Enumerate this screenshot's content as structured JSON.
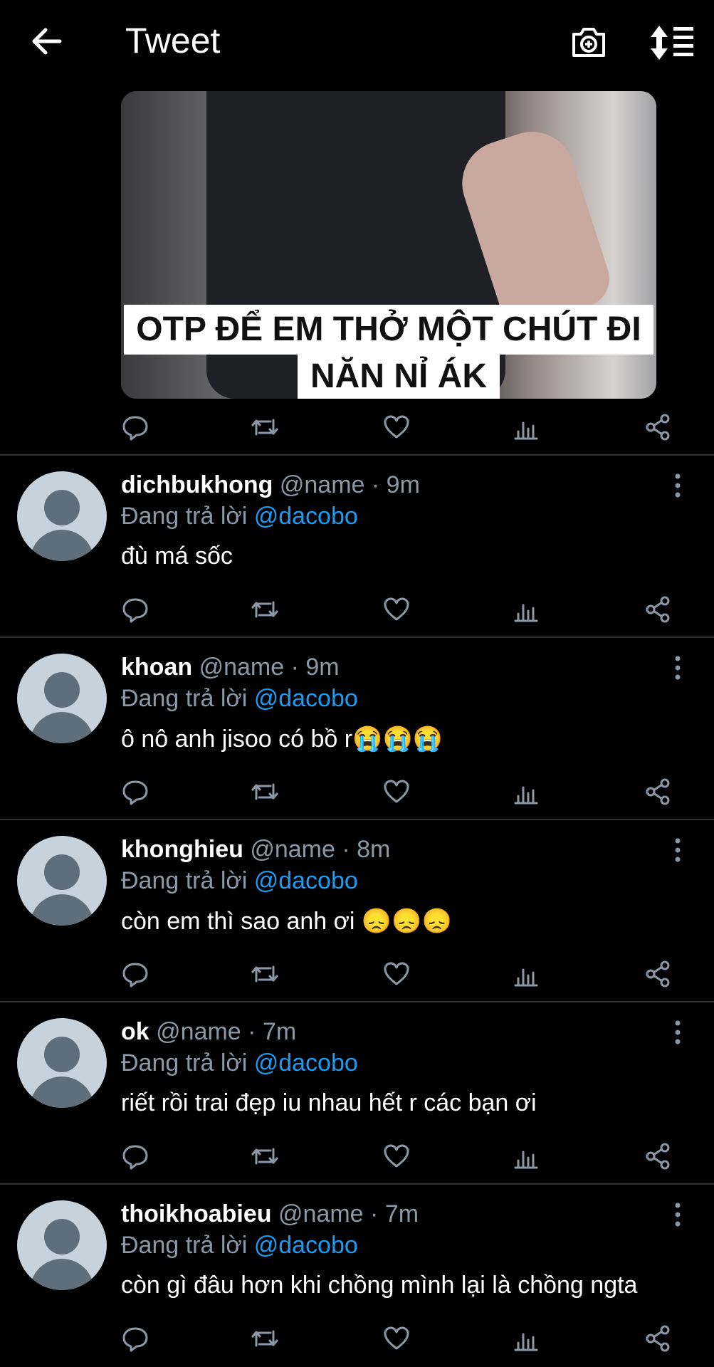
{
  "header": {
    "title": "Tweet",
    "back_icon": "arrow-left-icon",
    "camera_icon": "camera-plus-icon",
    "sort_icon": "sort-list-icon"
  },
  "media": {
    "caption_line1": "OTP ĐỂ EM THỞ MỘT CHÚT ĐI",
    "caption_line2": "NĂN NỈ ÁK"
  },
  "replying_prefix": "Đang trả lời ",
  "replies": [
    {
      "username": "dichbukhong",
      "handle": "@name",
      "time": "9m",
      "mention": "@dacobo",
      "text": "đù má sốc"
    },
    {
      "username": "khoan",
      "handle": "@name",
      "time": "9m",
      "mention": "@dacobo",
      "text": "ô nô anh jisoo có bồ r😭😭😭"
    },
    {
      "username": "khonghieu",
      "handle": "@name",
      "time": "8m",
      "mention": "@dacobo",
      "text": "còn em thì sao anh ơi 😞😞😞"
    },
    {
      "username": "ok",
      "handle": "@name",
      "time": "7m",
      "mention": "@dacobo",
      "text": "riết rồi trai đẹp iu nhau hết r các bạn ơi"
    },
    {
      "username": "thoikhoabieu",
      "handle": "@name",
      "time": "7m",
      "mention": "@dacobo",
      "text": "còn gì đâu hơn khi chồng mình lại là chồng ngta"
    }
  ],
  "colors": {
    "background": "#000000",
    "secondary_text": "#8b98a5",
    "link": "#1d9bf0",
    "divider": "#2f3336"
  }
}
